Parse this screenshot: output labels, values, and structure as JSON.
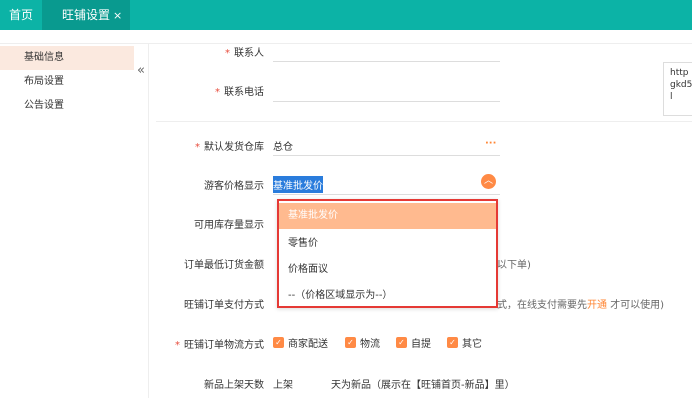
{
  "tabs": {
    "home": "首页",
    "active": "旺铺设置",
    "close": "×"
  },
  "sidebar": {
    "items": [
      {
        "label": "基础信息"
      },
      {
        "label": "布局设置"
      },
      {
        "label": "公告设置"
      }
    ],
    "collapse_icon": "«"
  },
  "form": {
    "contact_label": "联系人",
    "phone_label": "联系电话",
    "textarea_value": "https://gkd5l",
    "textarea_line1": "http",
    "textarea_line2": "gkd5",
    "textarea_line3": "l",
    "warehouse_label": "默认发货仓库",
    "warehouse_value": "总仓",
    "warehouse_more": "···",
    "guest_price_label": "游客价格显示",
    "guest_price_value": "基准批发价",
    "stock_label": "可用库存量显示",
    "min_order_label": "订单最低订货金额",
    "min_order_hint": "以下单)",
    "pay_label": "旺铺订单支付方式",
    "pay_hint_pre": "式，在线支付需要先",
    "pay_hint_link": "开通",
    "pay_hint_post": "才可以使用)",
    "logistics_label": "旺铺订单物流方式",
    "logistics_options": [
      "商家配送",
      "物流",
      "自提",
      "其它"
    ],
    "new_days_label": "新品上架天数",
    "new_days_prefix": "上架",
    "new_days_suffix": "天为新品（展示在【旺铺首页-新品】里）",
    "required_mark": "*"
  },
  "dropdown": {
    "options": [
      "基准批发价",
      "零售价",
      "价格面议",
      "--（价格区域显示为--）"
    ]
  }
}
